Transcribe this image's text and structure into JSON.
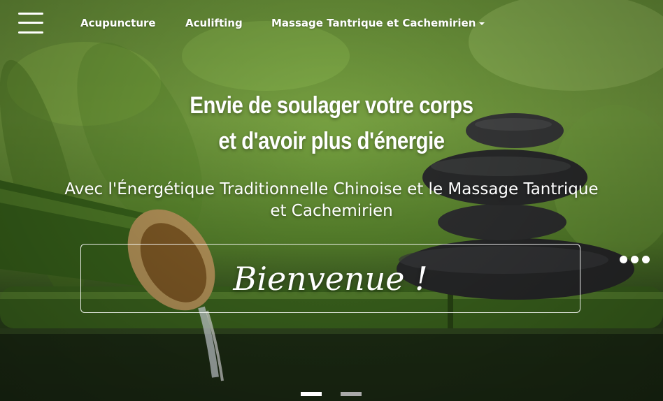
{
  "nav": {
    "menu_icon": "hamburger-menu-icon",
    "links": [
      {
        "label": "Acupuncture"
      },
      {
        "label": "Aculifting"
      },
      {
        "label": "Massage Tantrique et Cachemirien",
        "dropdown_icon": "caret-down-icon"
      }
    ]
  },
  "hero": {
    "headline_line1": "Envie de soulager votre corps",
    "headline_line2": "et d'avoir plus d'énergie",
    "subheadline": "Avec l'Énergétique Traditionnelle Chinoise et le Massage Tantrique et Cachemirien",
    "welcome": "Bienvenue !",
    "more_icon": "more-dots-icon"
  },
  "slider": {
    "slide_count": 2,
    "active_index": 0
  },
  "colors": {
    "text": "#ffffff",
    "indicator_active": "#ffffff",
    "indicator_inactive": "#a9a9a9",
    "background_green": "#6f9a3c"
  }
}
